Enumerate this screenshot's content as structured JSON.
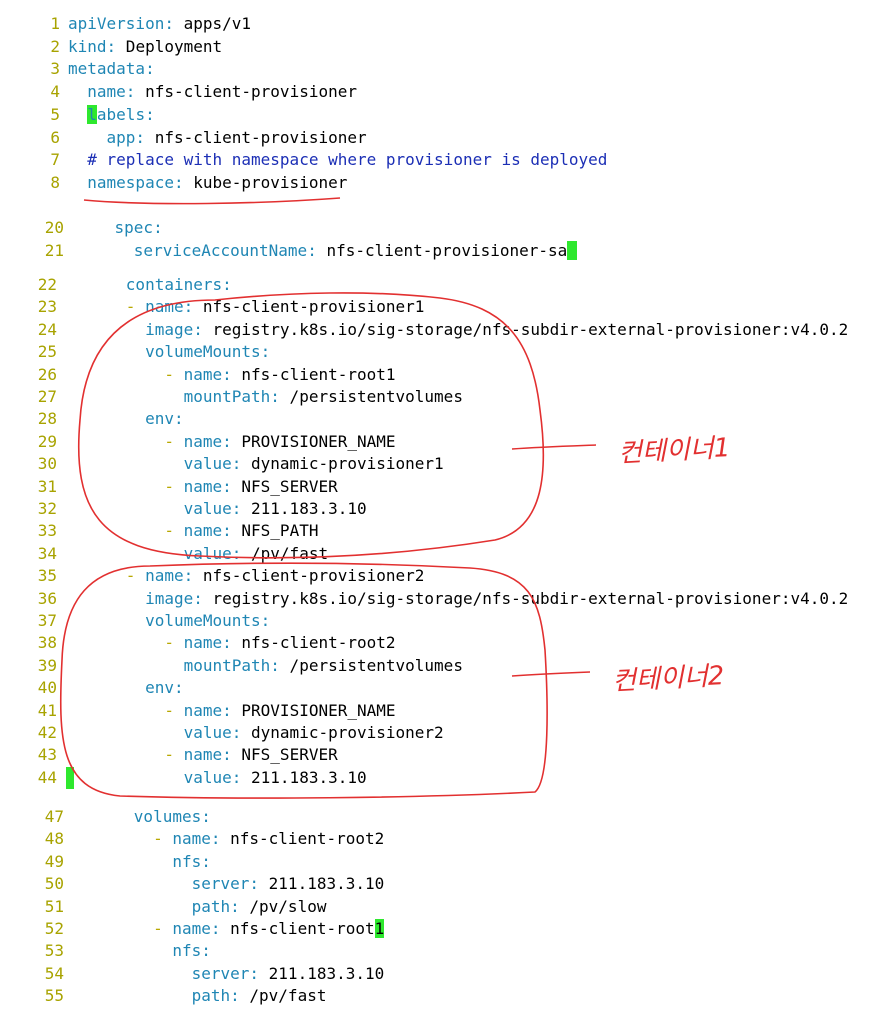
{
  "editor": {
    "section1": [
      {
        "num": "1",
        "indent": "",
        "dash": "",
        "key": "apiVersion",
        "value": "apps/v1"
      },
      {
        "num": "2",
        "indent": "",
        "dash": "",
        "key": "kind",
        "value": "Deployment"
      },
      {
        "num": "3",
        "indent": "",
        "dash": "",
        "key": "metadata",
        "value": ""
      },
      {
        "num": "4",
        "indent": "  ",
        "dash": "",
        "key": "name",
        "value": "nfs-client-provisioner"
      },
      {
        "num": "5",
        "indent": "  ",
        "dash": "",
        "key": "labels",
        "value": "",
        "cursor_first_char": true
      },
      {
        "num": "6",
        "indent": "    ",
        "dash": "",
        "key": "app",
        "value": "nfs-client-provisioner"
      },
      {
        "num": "7",
        "indent": "  ",
        "dash": "",
        "comment": "# replace with namespace where provisioner is deployed"
      },
      {
        "num": "8",
        "indent": "  ",
        "dash": "",
        "key": "namespace",
        "value": "kube-provisioner"
      }
    ],
    "section2": [
      {
        "num": "20",
        "indent": "    ",
        "dash": "",
        "key": "spec",
        "value": ""
      },
      {
        "num": "21",
        "indent": "      ",
        "dash": "",
        "key": "serviceAccountName",
        "value": "nfs-client-provisioner-sa",
        "cursor_after": true
      }
    ],
    "section3": [
      {
        "num": "22",
        "indent": "      ",
        "dash": "",
        "key": "containers",
        "value": ""
      },
      {
        "num": "23",
        "indent": "      ",
        "dash": "- ",
        "key": "name",
        "value": "nfs-client-provisioner1"
      },
      {
        "num": "24",
        "indent": "        ",
        "dash": "",
        "key": "image",
        "value": "registry.k8s.io/sig-storage/nfs-subdir-external-provisioner:v4.0.2"
      },
      {
        "num": "25",
        "indent": "        ",
        "dash": "",
        "key": "volumeMounts",
        "value": ""
      },
      {
        "num": "26",
        "indent": "          ",
        "dash": "- ",
        "key": "name",
        "value": "nfs-client-root1"
      },
      {
        "num": "27",
        "indent": "            ",
        "dash": "",
        "key": "mountPath",
        "value": "/persistentvolumes"
      },
      {
        "num": "28",
        "indent": "        ",
        "dash": "",
        "key": "env",
        "value": ""
      },
      {
        "num": "29",
        "indent": "          ",
        "dash": "- ",
        "key": "name",
        "value": "PROVISIONER_NAME"
      },
      {
        "num": "30",
        "indent": "            ",
        "dash": "",
        "key": "value",
        "value": "dynamic-provisioner1"
      },
      {
        "num": "31",
        "indent": "          ",
        "dash": "- ",
        "key": "name",
        "value": "NFS_SERVER"
      },
      {
        "num": "32",
        "indent": "            ",
        "dash": "",
        "key": "value",
        "value": "211.183.3.10"
      },
      {
        "num": "33",
        "indent": "          ",
        "dash": "- ",
        "key": "name",
        "value": "NFS_PATH"
      },
      {
        "num": "34",
        "indent": "            ",
        "dash": "",
        "key": "value",
        "value": "/pv/fast"
      },
      {
        "num": "35",
        "indent": "      ",
        "dash": "- ",
        "key": "name",
        "value": "nfs-client-provisioner2"
      },
      {
        "num": "36",
        "indent": "        ",
        "dash": "",
        "key": "image",
        "value": "registry.k8s.io/sig-storage/nfs-subdir-external-provisioner:v4.0.2"
      },
      {
        "num": "37",
        "indent": "        ",
        "dash": "",
        "key": "volumeMounts",
        "value": ""
      },
      {
        "num": "38",
        "indent": "          ",
        "dash": "- ",
        "key": "name",
        "value": "nfs-client-root2"
      },
      {
        "num": "39",
        "indent": "            ",
        "dash": "",
        "key": "mountPath",
        "value": "/persistentvolumes"
      },
      {
        "num": "40",
        "indent": "        ",
        "dash": "",
        "key": "env",
        "value": ""
      },
      {
        "num": "41",
        "indent": "          ",
        "dash": "- ",
        "key": "name",
        "value": "PROVISIONER_NAME"
      },
      {
        "num": "42",
        "indent": "            ",
        "dash": "",
        "key": "value",
        "value": "dynamic-provisioner2"
      },
      {
        "num": "43",
        "indent": "          ",
        "dash": "- ",
        "key": "name",
        "value": "NFS_SERVER"
      },
      {
        "num": "44",
        "indent": "            ",
        "dash": "",
        "key": "value",
        "value": "211.183.3.10",
        "cursor_line_start": true
      }
    ],
    "section4": [
      {
        "num": "47",
        "indent": "      ",
        "dash": "",
        "key": "volumes",
        "value": ""
      },
      {
        "num": "48",
        "indent": "        ",
        "dash": "- ",
        "key": "name",
        "value": "nfs-client-root2"
      },
      {
        "num": "49",
        "indent": "          ",
        "dash": "",
        "key": "nfs",
        "value": ""
      },
      {
        "num": "50",
        "indent": "            ",
        "dash": "",
        "key": "server",
        "value": "211.183.3.10"
      },
      {
        "num": "51",
        "indent": "            ",
        "dash": "",
        "key": "path",
        "value": "/pv/slow"
      },
      {
        "num": "52",
        "indent": "        ",
        "dash": "- ",
        "key": "name",
        "value": "nfs-client-root1",
        "cursor_last_char": true
      },
      {
        "num": "53",
        "indent": "          ",
        "dash": "",
        "key": "nfs",
        "value": ""
      },
      {
        "num": "54",
        "indent": "            ",
        "dash": "",
        "key": "server",
        "value": "211.183.3.10"
      },
      {
        "num": "55",
        "indent": "            ",
        "dash": "",
        "key": "path",
        "value": "/pv/fast"
      }
    ]
  },
  "annotations": {
    "container1_label": "컨테이너1",
    "container2_label": "컨테이너2"
  },
  "colors": {
    "key": "#1f86b4",
    "comment": "#1c2fb5",
    "line_number": "#a8a300",
    "cursor": "#2ee82e",
    "annotation": "#e23030"
  }
}
